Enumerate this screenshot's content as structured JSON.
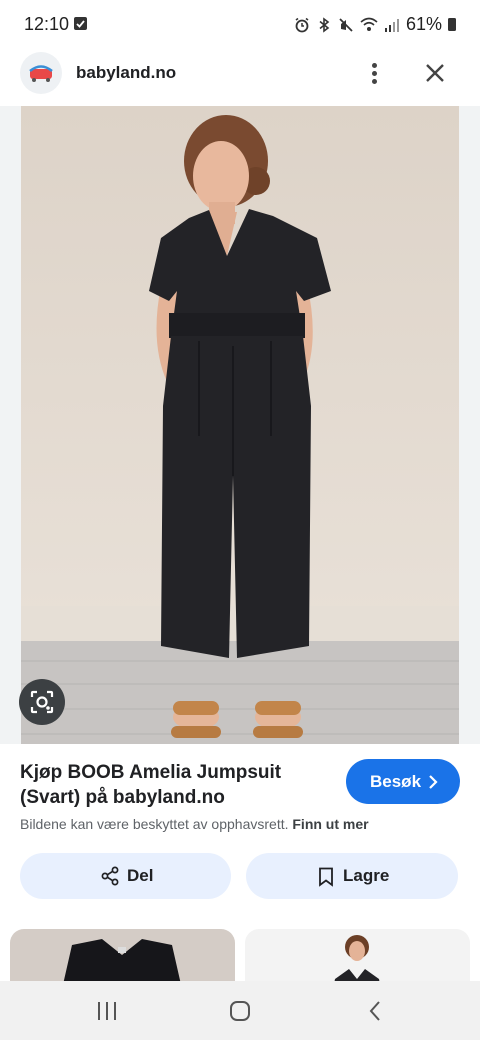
{
  "status_bar": {
    "time": "12:10",
    "battery": "61%",
    "icons": [
      "notification-check-icon",
      "alarm-icon",
      "bluetooth-icon",
      "mute-icon",
      "wifi-icon",
      "signal-icon",
      "battery-icon"
    ]
  },
  "header": {
    "site_name": "babyland.no",
    "icons": [
      "site-favicon",
      "more-vert-icon",
      "close-icon"
    ]
  },
  "image": {
    "lens_icon": "google-lens-icon"
  },
  "result": {
    "title_line1": "Kjøp BOOB Amelia Jumpsuit",
    "title_line2": "(Svart) på babyland.no",
    "copyright_text": "Bildene kan være beskyttet av opphavsrett.",
    "learn_more": "Finn ut mer",
    "visit_label": "Besøk"
  },
  "actions": {
    "share_label": "Del",
    "save_label": "Lagre"
  },
  "nav": {
    "icons": [
      "recents-icon",
      "home-icon",
      "back-icon"
    ]
  },
  "colors": {
    "accent": "#1a73e8",
    "pill": "#e8f0fe",
    "text": "#202124",
    "secondary_text": "#5f6368"
  }
}
